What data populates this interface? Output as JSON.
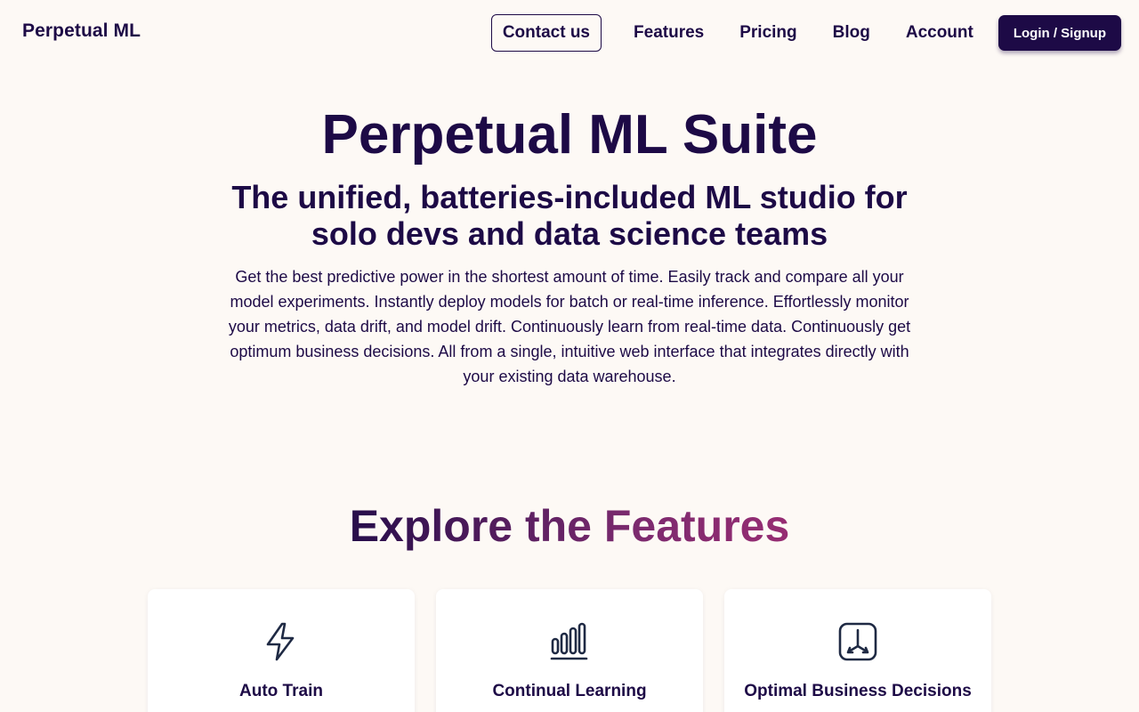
{
  "header": {
    "brand": "Perpetual ML",
    "nav": {
      "contact": "Contact us",
      "features": "Features",
      "pricing": "Pricing",
      "blog": "Blog",
      "account": "Account",
      "login": "Login / Signup"
    }
  },
  "hero": {
    "title": "Perpetual ML Suite",
    "subtitle": "The unified, batteries-included ML studio for solo devs and data science teams",
    "description": "Get the best predictive power in the shortest amount of time. Easily track and compare all your model experiments. Instantly deploy models for batch or real-time inference. Effortlessly monitor your metrics, data drift, and model drift. Continuously learn from real-time data. Continuously get optimum business decisions. All from a single, intuitive web interface that integrates directly with your existing data warehouse."
  },
  "features": {
    "heading": "Explore the Features",
    "cards": [
      {
        "title": "Auto Train",
        "icon": "lightning-icon"
      },
      {
        "title": "Continual Learning",
        "icon": "bar-chart-icon"
      },
      {
        "title": "Optimal Business Decisions",
        "icon": "axes-icon"
      }
    ]
  },
  "colors": {
    "primary": "#1d0a46",
    "background": "#fdf9f5",
    "accent_gradient_end": "#d4317d",
    "icon_stroke": "#1f2a44"
  }
}
